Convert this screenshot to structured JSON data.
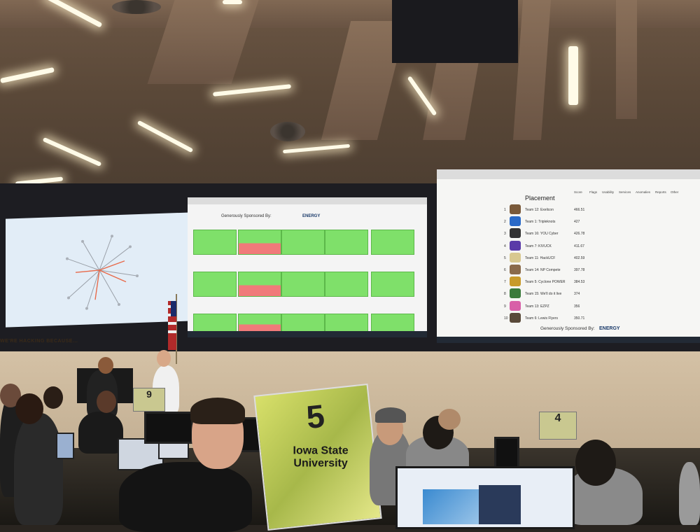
{
  "scene": {
    "wall_text": "WE'RE HACKING BECAUSE..."
  },
  "left_screen": {
    "chart": "radar-chart"
  },
  "middle_screen": {
    "sponsor_label": "Generously Sponsored By:",
    "sponsor_logo": "ENERGY"
  },
  "right_screen": {
    "title": "Placement",
    "columns": [
      "Score",
      "Flags",
      "Usability",
      "Services",
      "Anomalies",
      "Reports",
      "Other"
    ],
    "rows": [
      {
        "rank": "1",
        "team": "Team 12: Exelicon",
        "score": "466.51",
        "color": "#7a5a3a"
      },
      {
        "rank": "2",
        "team": "Team 1: Tripleknots",
        "score": "427",
        "color": "#2a6ac8"
      },
      {
        "rank": "3",
        "team": "Team 16: YOU Cyber",
        "score": "426.78",
        "color": "#333333"
      },
      {
        "rank": "4",
        "team": "Team 7: KIVUCK",
        "score": "411.67",
        "color": "#5a3aa8"
      },
      {
        "rank": "5",
        "team": "Team 11: HackUCF",
        "score": "402.59",
        "color": "#d8c890"
      },
      {
        "rank": "6",
        "team": "Team 14: NP Compete",
        "score": "397.78",
        "color": "#8a6a4a"
      },
      {
        "rank": "7",
        "team": "Team 5: Cyclone POWER",
        "score": "384.53",
        "color": "#c89a2a"
      },
      {
        "rank": "8",
        "team": "Team 15: We'll do it live",
        "score": "374",
        "color": "#3a7a3a"
      },
      {
        "rank": "9",
        "team": "Team 13: EZPZ",
        "score": "356",
        "color": "#d860a8"
      },
      {
        "rank": "10",
        "team": "Team 6: Lewis Flyers",
        "score": "350.71",
        "color": "#5a4a3a"
      }
    ],
    "sponsor_label": "Generously Sponsored By:",
    "sponsor_logo": "ENERGY"
  },
  "signs": {
    "iowa_number": "5",
    "iowa_text": "Iowa State University",
    "table9_number": "9",
    "table4_number": "4"
  }
}
